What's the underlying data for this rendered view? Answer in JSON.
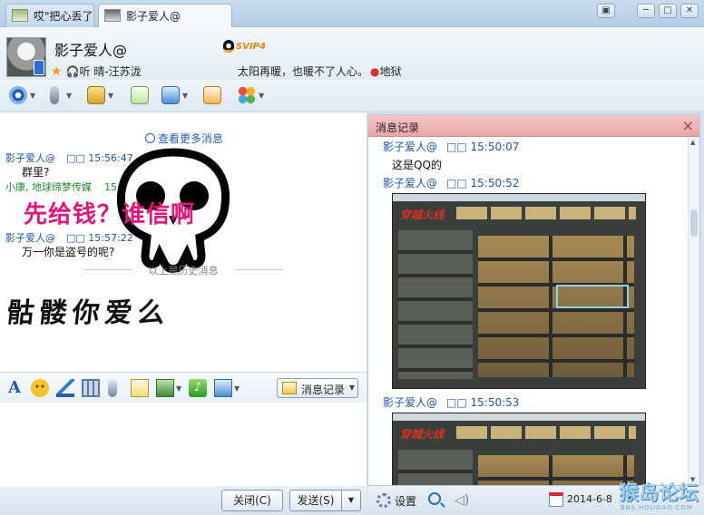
{
  "tabs": [
    {
      "label": "哎\"把心丢了"
    },
    {
      "label": "影子爱人@"
    }
  ],
  "contact": {
    "name": "影子爱人@",
    "badge": "SVIP4",
    "listening": "听 晴-汪苏泷",
    "signature": "太阳再暖，也暖不了人心。",
    "location": "地狱"
  },
  "chat": {
    "more_link": "查看更多消息",
    "messages": [
      {
        "sender": "影子爱人@",
        "time": "□□  15:56:47",
        "text": "群里?"
      },
      {
        "sender": "小康, 地球缔梦传媒",
        "time": "15:57:01",
        "text": ""
      },
      {
        "sender": "影子爱人@",
        "time": "□□  15:57:22",
        "text": "万一你是盗号的呢?"
      }
    ],
    "history_divider": "以上是历史消息",
    "overlay_text": "先给钱？谁信啊",
    "scrawl_text": "骷髅你爱么"
  },
  "format_bar": {
    "history_button": "消息记录"
  },
  "buttons": {
    "close": "关闭(C)",
    "send": "发送(S)"
  },
  "history_panel": {
    "title": "消息记录",
    "entries": [
      {
        "sender": "影子爱人@",
        "time": "□□  15:50:07",
        "text": "这是QQ的"
      },
      {
        "sender": "影子爱人@",
        "time": "□□  15:50:52",
        "text": ""
      },
      {
        "sender": "影子爱人@",
        "time": "□□  15:50:53",
        "text": ""
      }
    ],
    "game_brand": "穿越火线",
    "settings_label": "设置",
    "date": "2014-6-8"
  },
  "watermark": {
    "text": "猴岛论坛",
    "url": "BBS.HOUDAO.COM"
  },
  "colors": {
    "link_blue": "#1f56b2",
    "green_name": "#1f8b2c",
    "overlay_pink": "#e3157a",
    "panel_header": "#eaa6a6"
  }
}
